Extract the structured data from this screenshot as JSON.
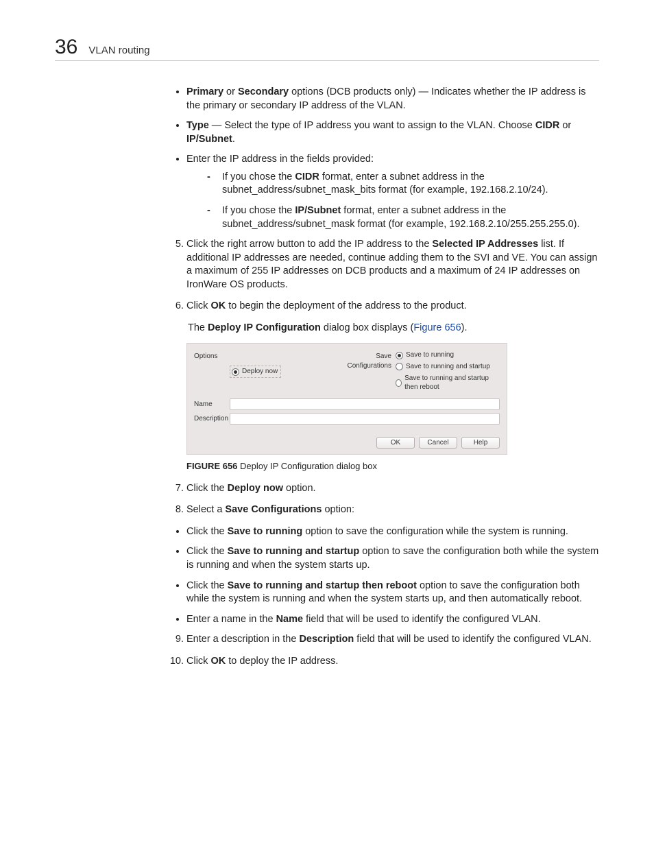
{
  "header": {
    "chapter_number": "36",
    "section_title": "VLAN routing"
  },
  "bullet_primary": {
    "b1": "Primary",
    "mid1": " or ",
    "b2": "Secondary",
    "rest": " options (DCB products only) — Indicates whether the IP address is the primary or secondary IP address of the VLAN."
  },
  "bullet_type": {
    "b1": "Type",
    "mid": " — Select the type of IP address you want to assign to the VLAN. Choose ",
    "b2": "CIDR",
    "mid2": " or ",
    "b3": "IP/Subnet",
    "end": "."
  },
  "bullet_enter_intro": "Enter the IP address in the fields provided:",
  "dash_cidr": {
    "pre": "If you chose the ",
    "b": "CIDR",
    "post": " format, enter a subnet address in the subnet_address/subnet_mask_bits format (for example, 192.168.2.10/24)."
  },
  "dash_ipsub": {
    "pre": "If you chose the ",
    "b": "IP/Subnet",
    "post": " format, enter a subnet address in the subnet_address/subnet_mask format (for example, 192.168.2.10/255.255.255.0)."
  },
  "step5": {
    "pre": "Click the right arrow button to add the IP address to the ",
    "b": "Selected IP Addresses",
    "post": " list. If additional IP addresses are needed, continue adding them to the SVI and VE. You can assign a maximum of 255 IP addresses on DCB products and a maximum of 24 IP addresses on IronWare OS products."
  },
  "step6": {
    "pre": "Click ",
    "b": "OK",
    "post": " to begin the deployment of the address to the product."
  },
  "step6_note": {
    "pre": "The ",
    "b": "Deploy IP Configuration",
    "mid": " dialog box displays (",
    "link": "Figure 656",
    "post": ")."
  },
  "dialog": {
    "options_label": "Options",
    "deploy_now": "Deploy now",
    "save_conf_label": "Save Configurations",
    "save_running": "Save to running",
    "save_running_startup": "Save to running and startup",
    "save_running_startup_reboot": "Save to running and startup then reboot",
    "name_label": "Name",
    "desc_label": "Description",
    "btn_ok": "OK",
    "btn_cancel": "Cancel",
    "btn_help": "Help"
  },
  "figcap": {
    "label": "FIGURE 656",
    "text": "  Deploy IP Configuration dialog box"
  },
  "step7": {
    "pre": "Click the ",
    "b": "Deploy now",
    "post": " option."
  },
  "step8": {
    "pre": "Select a ",
    "b": "Save Configurations",
    "post": " option:"
  },
  "bullet_sr": {
    "pre": "Click the ",
    "b": "Save to running",
    "post": " option to save the configuration while the system is running."
  },
  "bullet_srs": {
    "pre": "Click the ",
    "b": "Save to running and startup",
    "post": " option to save the configuration both while the system is running and when the system starts up."
  },
  "bullet_srsr": {
    "pre": "Click the ",
    "b": "Save to running and startup then reboot",
    "post": " option to save the configuration both while the system is running and when the system starts up, and then automatically reboot."
  },
  "bullet_name": {
    "pre": "Enter a name in the ",
    "b": "Name",
    "post": " field that will be used to identify the configured VLAN."
  },
  "step9": {
    "pre": "Enter a description in the ",
    "b": "Description",
    "post": " field that will be used to identify the configured VLAN."
  },
  "step10": {
    "pre": "Click ",
    "b": "OK",
    "post": " to deploy the IP address."
  }
}
